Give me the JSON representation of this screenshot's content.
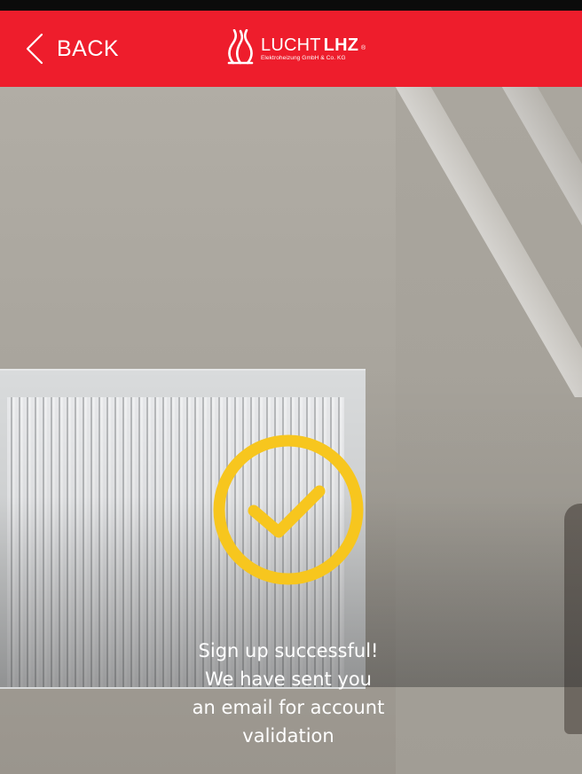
{
  "header": {
    "back_label": "BACK",
    "logo": {
      "brand_light": "LUCHT",
      "brand_bold": "LHZ",
      "subtitle": "Elektroheizung GmbH & Co. KG",
      "registered": "®"
    },
    "background_color": "#ee1d2c"
  },
  "success": {
    "icon": "checkmark-circle-icon",
    "icon_color": "#f7c61e",
    "message_lines": [
      "Sign up successful!",
      "We have sent you",
      "an email for account",
      "validation"
    ]
  },
  "icons": {
    "back": "chevron-left-icon",
    "logo": "flame-logo-icon"
  }
}
